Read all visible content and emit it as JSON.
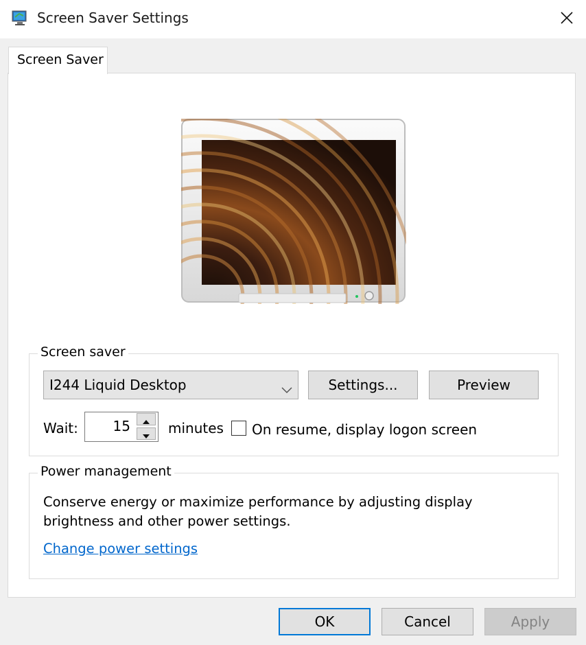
{
  "window": {
    "title": "Screen Saver Settings",
    "app_icon": "display-settings-icon",
    "close_icon": "close-icon"
  },
  "tabs": [
    {
      "label": "Screen Saver",
      "selected": true
    }
  ],
  "preview": {
    "description": "Monitor preview showing liquid ripple screen saver",
    "power_led_color": "#22c55e"
  },
  "screen_saver_group": {
    "legend": "Screen saver",
    "selected_saver": "I244 Liquid Desktop",
    "settings_button": "Settings...",
    "preview_button": "Preview",
    "wait_label": "Wait:",
    "wait_value": "15",
    "minutes_label": "minutes",
    "logon_checkbox_label": "On resume, display logon screen",
    "logon_checked": false
  },
  "power_group": {
    "legend": "Power management",
    "description": "Conserve energy or maximize performance by adjusting display brightness and other power settings.",
    "link_text": "Change power settings"
  },
  "footer": {
    "ok": "OK",
    "cancel": "Cancel",
    "apply": "Apply",
    "apply_enabled": false
  },
  "colors": {
    "accent": "#0078d7",
    "link": "#0066cc",
    "dialog_bg": "#f0f0f0"
  }
}
